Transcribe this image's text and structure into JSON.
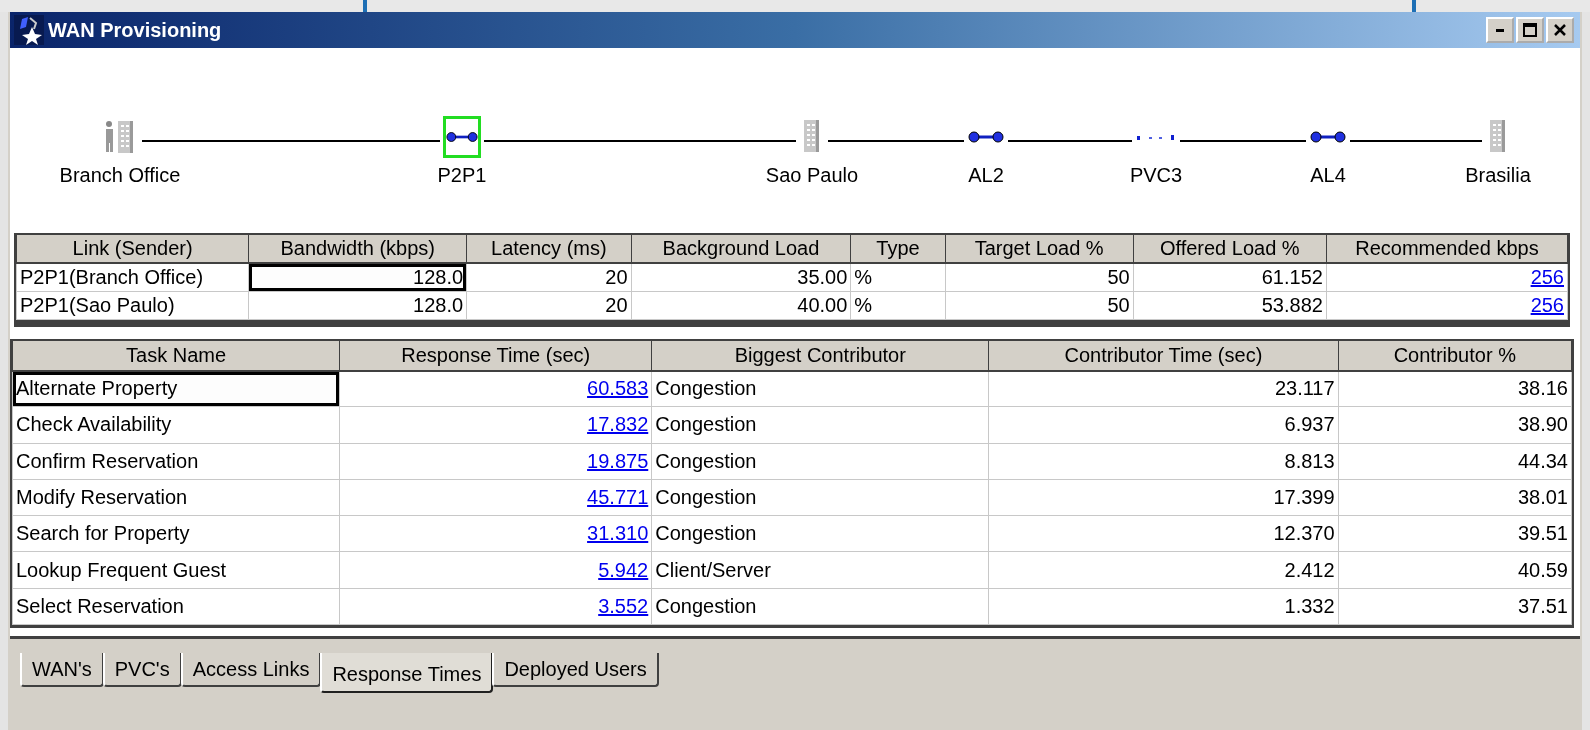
{
  "window": {
    "title": "WAN Provisioning"
  },
  "diagram": {
    "nodes": [
      {
        "label": "Branch Office",
        "kind": "office",
        "selected": false
      },
      {
        "label": "P2P1",
        "kind": "link",
        "selected": true
      },
      {
        "label": "Sao Paulo",
        "kind": "site",
        "selected": false
      },
      {
        "label": "AL2",
        "kind": "link",
        "selected": false
      },
      {
        "label": "PVC3",
        "kind": "pvc",
        "selected": false
      },
      {
        "label": "AL4",
        "kind": "link",
        "selected": false
      },
      {
        "label": "Brasilia",
        "kind": "site",
        "selected": false
      }
    ]
  },
  "links_table": {
    "columns": [
      {
        "label": "Link (Sender)",
        "kind": "text"
      },
      {
        "label": "Bandwidth (kbps)",
        "kind": "number"
      },
      {
        "label": "Latency (ms)",
        "kind": "number"
      },
      {
        "label": "Background Load",
        "kind": "number"
      },
      {
        "label": "Type",
        "kind": "text"
      },
      {
        "label": "Target Load %",
        "kind": "number"
      },
      {
        "label": "Offered Load %",
        "kind": "number"
      },
      {
        "label": "Recommended kbps",
        "kind": "link"
      }
    ],
    "rows": [
      {
        "cells": [
          {
            "text": "P2P1(Branch Office)",
            "focused": false
          },
          {
            "text": "128.0",
            "focused": true
          },
          {
            "text": "20",
            "focused": false
          },
          {
            "text": "35.00",
            "focused": false
          },
          {
            "text": "%",
            "focused": false
          },
          {
            "text": "50",
            "focused": false
          },
          {
            "text": "61.152",
            "focused": false
          },
          {
            "text": "256",
            "focused": false
          }
        ]
      },
      {
        "cells": [
          {
            "text": "P2P1(Sao Paulo)",
            "focused": false
          },
          {
            "text": "128.0",
            "focused": false
          },
          {
            "text": "20",
            "focused": false
          },
          {
            "text": "40.00",
            "focused": false
          },
          {
            "text": "%",
            "focused": false
          },
          {
            "text": "50",
            "focused": false
          },
          {
            "text": "53.882",
            "focused": false
          },
          {
            "text": "256",
            "focused": false
          }
        ]
      }
    ]
  },
  "tasks_table": {
    "columns": [
      {
        "label": "Task Name",
        "kind": "text"
      },
      {
        "label": "Response Time (sec)",
        "kind": "link"
      },
      {
        "label": "Biggest Contributor",
        "kind": "text"
      },
      {
        "label": "Contributor Time (sec)",
        "kind": "number"
      },
      {
        "label": "Contributor %",
        "kind": "number"
      }
    ],
    "rows": [
      {
        "cells": [
          {
            "text": "Alternate Property",
            "focused": true
          },
          {
            "text": "60.583",
            "focused": false
          },
          {
            "text": "Congestion",
            "focused": false
          },
          {
            "text": "23.117",
            "focused": false
          },
          {
            "text": "38.16",
            "focused": false
          }
        ]
      },
      {
        "cells": [
          {
            "text": "Check Availability",
            "focused": false
          },
          {
            "text": "17.832",
            "focused": false
          },
          {
            "text": "Congestion",
            "focused": false
          },
          {
            "text": "6.937",
            "focused": false
          },
          {
            "text": "38.90",
            "focused": false
          }
        ]
      },
      {
        "cells": [
          {
            "text": "Confirm Reservation",
            "focused": false
          },
          {
            "text": "19.875",
            "focused": false
          },
          {
            "text": "Congestion",
            "focused": false
          },
          {
            "text": "8.813",
            "focused": false
          },
          {
            "text": "44.34",
            "focused": false
          }
        ]
      },
      {
        "cells": [
          {
            "text": "Modify Reservation",
            "focused": false
          },
          {
            "text": "45.771",
            "focused": false
          },
          {
            "text": "Congestion",
            "focused": false
          },
          {
            "text": "17.399",
            "focused": false
          },
          {
            "text": "38.01",
            "focused": false
          }
        ]
      },
      {
        "cells": [
          {
            "text": "Search for Property",
            "focused": false
          },
          {
            "text": "31.310",
            "focused": false
          },
          {
            "text": "Congestion",
            "focused": false
          },
          {
            "text": "12.370",
            "focused": false
          },
          {
            "text": "39.51",
            "focused": false
          }
        ]
      },
      {
        "cells": [
          {
            "text": "Lookup Frequent Guest",
            "focused": false
          },
          {
            "text": "5.942",
            "focused": false
          },
          {
            "text": "Client/Server",
            "focused": false
          },
          {
            "text": "2.412",
            "focused": false
          },
          {
            "text": "40.59",
            "focused": false
          }
        ]
      },
      {
        "cells": [
          {
            "text": "Select Reservation",
            "focused": false
          },
          {
            "text": "3.552",
            "focused": false
          },
          {
            "text": "Congestion",
            "focused": false
          },
          {
            "text": "1.332",
            "focused": false
          },
          {
            "text": "37.51",
            "focused": false
          }
        ]
      }
    ]
  },
  "tabs": [
    {
      "label": "WAN's",
      "selected": false
    },
    {
      "label": "PVC's",
      "selected": false
    },
    {
      "label": "Access Links",
      "selected": false
    },
    {
      "label": "Response Times",
      "selected": true
    },
    {
      "label": "Deployed Users",
      "selected": false
    }
  ]
}
